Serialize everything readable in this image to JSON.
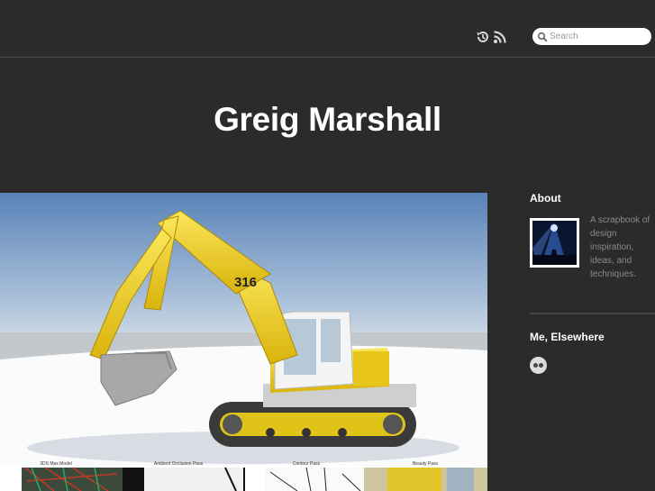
{
  "header": {
    "search_placeholder": "Search",
    "icons": [
      "history-icon",
      "rss-icon",
      "search-icon"
    ]
  },
  "site": {
    "title": "Greig Marshall"
  },
  "post": {
    "image_labels": [
      "3DS Max Model",
      "Ambient Occlusion Pass",
      "Contour Pass",
      "Beauty Pass"
    ],
    "machine_number": "316"
  },
  "sidebar": {
    "about_heading": "About",
    "about_text": "A scrapbook of design inspiration, ideas, and techniques.",
    "elsewhere_heading": "Me, Elsewhere",
    "elsewhere_icons": [
      "flickr-icon"
    ]
  },
  "colors": {
    "background": "#2b2b2b",
    "text": "#ffffff",
    "muted_text": "#8a8a8a",
    "excavator_yellow": "#f2d21a"
  }
}
